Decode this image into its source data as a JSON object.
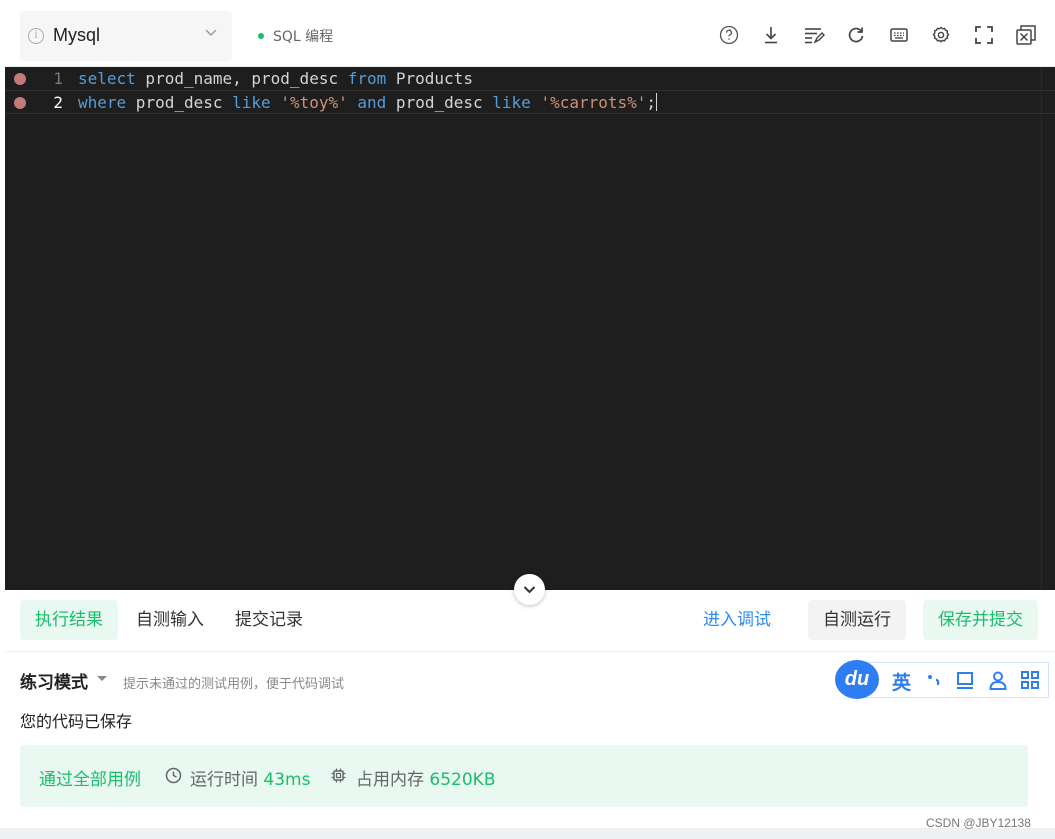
{
  "toolbar": {
    "language": "Mysql",
    "mode_badge": "SQL 编程",
    "status_color": "#19be6b",
    "icons": [
      "help-icon",
      "download-icon",
      "format-icon",
      "reset-icon",
      "keyboard-icon",
      "settings-icon",
      "fullscreen-icon",
      "close-panel-icon"
    ]
  },
  "editor": {
    "line1": {
      "num": "1",
      "kw1": "select",
      "t1": " prod_name, prod_desc ",
      "kw2": "from",
      "t2": " Products"
    },
    "line2": {
      "num": "2",
      "kw1": "where",
      "t1": " prod_desc ",
      "kw2": "like",
      "t2": " ",
      "s1": "'%toy%'",
      "t3": " ",
      "kw3": "and",
      "t4": " prod_desc ",
      "kw4": "like",
      "t5": " ",
      "s2": "'%carrots%'",
      "t6": ";"
    }
  },
  "result_bar": {
    "tabs": [
      "执行结果",
      "自测输入",
      "提交记录"
    ],
    "debug_label": "进入调试",
    "run_label": "自测运行",
    "submit_label": "保存并提交"
  },
  "practice": {
    "title": "练习模式",
    "hint": "提示未通过的测试用例，便于代码调试",
    "saved": "您的代码已保存"
  },
  "result": {
    "status": "通过全部用例",
    "time_label": "运行时间",
    "time_value": "43ms",
    "memory_label": "占用内存",
    "memory_value": "6520KB"
  },
  "ime": {
    "logo": "du",
    "lang": "英"
  },
  "watermark": "CSDN @JBY12138"
}
